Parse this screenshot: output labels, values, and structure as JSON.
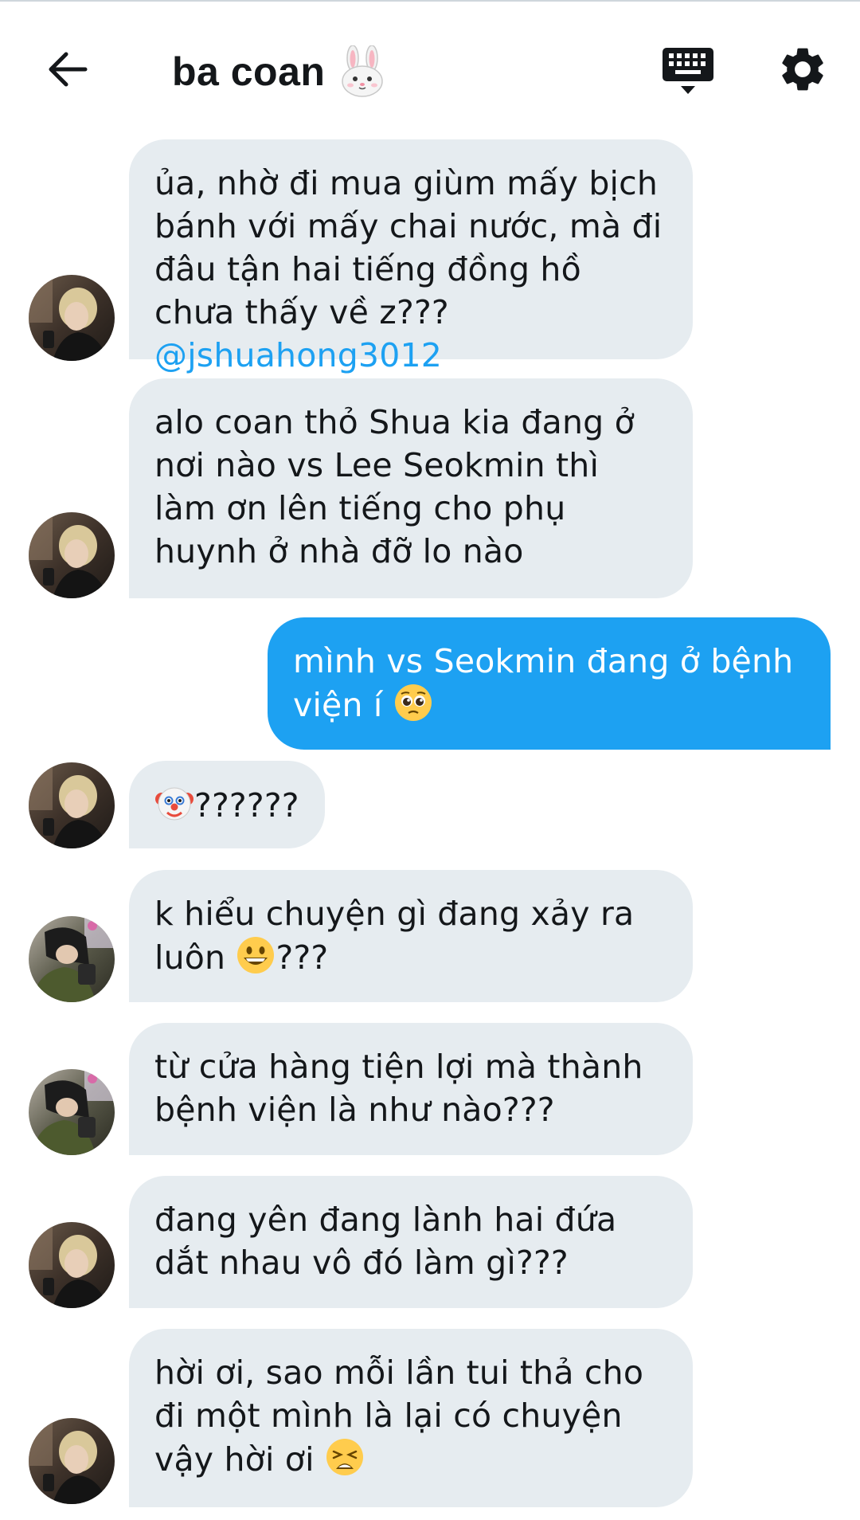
{
  "header": {
    "title": "ba coan",
    "title_icon": "rabbit-face-icon",
    "back_icon": "arrow-left-icon",
    "keyboard_icon": "keyboard-icon",
    "settings_icon": "gear-icon"
  },
  "colors": {
    "received_bubble": "#e6ecf0",
    "sent_bubble": "#1da1f2",
    "mention": "#1da1f2",
    "text": "#14171a"
  },
  "messages": [
    {
      "sender": "other",
      "text": "ủa, nhờ đi mua giùm mấy bịch bánh với mấy chai nước, mà đi đâu tận hai tiếng đồng hồ chưa thấy về z??? ",
      "mention": "@jshuahong3012"
    },
    {
      "sender": "other",
      "text": "alo coan thỏ Shua kia đang ở nơi nào vs Lee Seokmin thì làm ơn lên tiếng cho phụ huynh ở nhà đỡ lo nào"
    },
    {
      "sender": "me",
      "text": "mình vs Seokmin đang ở bệnh viện í",
      "emoji": "pleading-face-icon"
    },
    {
      "sender": "other",
      "emoji_before": "clown-face-icon",
      "text": "??????"
    },
    {
      "sender": "other2",
      "text": "k hiểu chuyện gì đang xảy ra luôn ",
      "emoji": "grinning-face-icon",
      "text_after": "???"
    },
    {
      "sender": "other2",
      "text": "từ cửa hàng tiện lợi mà thành bệnh viện là như nào???"
    },
    {
      "sender": "other",
      "text": "đang yên đang lành hai đứa dắt nhau vô đó làm gì???"
    },
    {
      "sender": "other",
      "text": "hời ơi, sao mỗi lần tui thả cho đi một mình là lại có chuyện vậy hời ơi ",
      "emoji": "tired-face-icon"
    }
  ]
}
